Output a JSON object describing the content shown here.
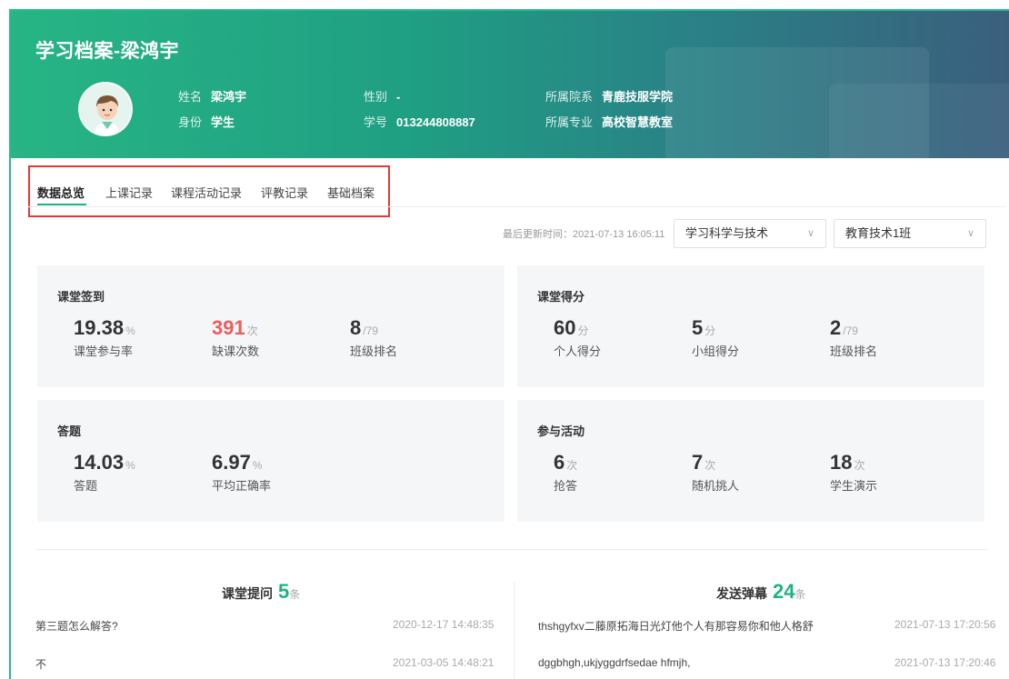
{
  "header": {
    "title": "学习档案-梁鸿宇",
    "name_label": "姓名",
    "name_value": "梁鸿宇",
    "role_label": "身份",
    "role_value": "学生",
    "gender_label": "性别",
    "gender_value": "-",
    "id_label": "学号",
    "id_value": "013244808887",
    "dept_label": "所属院系",
    "dept_value": "青鹿技服学院",
    "major_label": "所属专业",
    "major_value": "高校智慧教室"
  },
  "tabs": [
    {
      "label": "数据总览",
      "active": true
    },
    {
      "label": "上课记录"
    },
    {
      "label": "课程活动记录"
    },
    {
      "label": "评教记录"
    },
    {
      "label": "基础档案"
    }
  ],
  "filters": {
    "updated_text": "最后更新时间：2021-07-13 16:05:11",
    "course": "学习科学与技术",
    "class": "教育技术1班"
  },
  "cards": {
    "attendance": {
      "title": "课堂签到",
      "stats": [
        {
          "value": "19.38",
          "unit": "%",
          "label": "课堂参与率"
        },
        {
          "value": "391",
          "unit": "次",
          "label": "缺课次数"
        },
        {
          "value": "8",
          "unit": "/79",
          "label": "班级排名"
        }
      ]
    },
    "score": {
      "title": "课堂得分",
      "stats": [
        {
          "value": "60",
          "unit": "分",
          "label": "个人得分"
        },
        {
          "value": "5",
          "unit": "分",
          "label": "小组得分"
        },
        {
          "value": "2",
          "unit": "/79",
          "label": "班级排名"
        }
      ]
    },
    "answer": {
      "title": "答题",
      "stats": [
        {
          "value": "14.03",
          "unit": "%",
          "label": "答题"
        },
        {
          "value": "6.97",
          "unit": "%",
          "label": "平均正确率"
        }
      ]
    },
    "activity": {
      "title": "参与活动",
      "stats": [
        {
          "value": "6",
          "unit": "次",
          "label": "抢答"
        },
        {
          "value": "7",
          "unit": "次",
          "label": "随机挑人"
        },
        {
          "value": "18",
          "unit": "次",
          "label": "学生演示"
        }
      ]
    }
  },
  "questions": {
    "title": "课堂提问",
    "count": "5",
    "unit": "条",
    "items": [
      {
        "text": "第三题怎么解答?",
        "time": "2020-12-17 14:48:35"
      },
      {
        "text": "不",
        "time": "2021-03-05 14:48:21"
      }
    ]
  },
  "danmu": {
    "title": "发送弹幕",
    "count": "24",
    "unit": "条",
    "items": [
      {
        "text": "thshgyfxv二藤原拓海日光灯他个人有那容易你和他人格舒",
        "time": "2021-07-13 17:20:56"
      },
      {
        "text": "dggbhgh,ukjyggdrfsedae hfmjh,",
        "time": "2021-07-13 17:20:46"
      }
    ]
  },
  "colors": {
    "accent": "#20b183",
    "danger": "#ef5b5b",
    "highlight_box": "#e53935"
  }
}
